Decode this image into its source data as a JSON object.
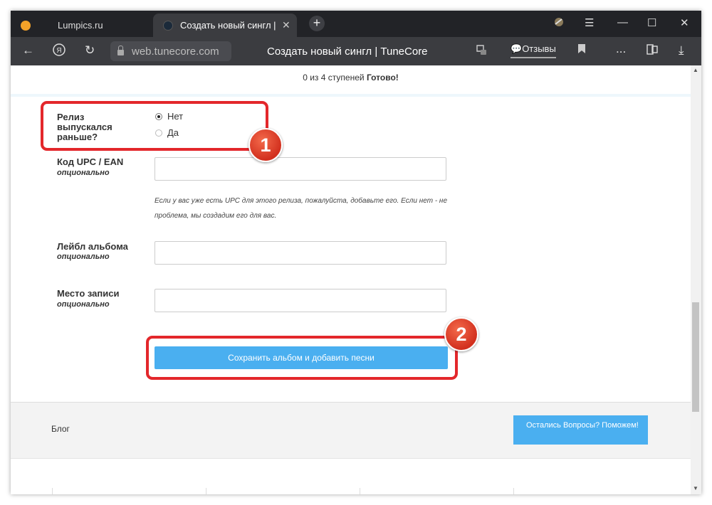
{
  "browser": {
    "tabs": [
      {
        "label": "Lumpics.ru",
        "active": false
      },
      {
        "label": "Создать новый сингл | TuneCore",
        "active": true
      }
    ],
    "new_tab_symbol": "+",
    "address": "web.tunecore.com",
    "page_title": "Создать новый сингл | TuneCore",
    "reviews_label": "Отзывы",
    "more_label": "...",
    "icons": [
      "back-icon",
      "yandex-icon",
      "reload-icon",
      "lock-icon",
      "extension-icon",
      "bookmark-icon",
      "collections-icon",
      "download-icon",
      "menu-icon",
      "minimize-icon",
      "maximize-icon",
      "close-icon"
    ]
  },
  "progress": {
    "text": "0 из 4 ступеней",
    "status": "Готово!"
  },
  "form": {
    "released_label": "Релиз выпускался раньше?",
    "released_options": [
      {
        "label": "Нет",
        "selected": true
      },
      {
        "label": "Да",
        "selected": false
      }
    ],
    "upc_label": "Код UPC / EAN",
    "upc_optional": "опционально",
    "upc_value": "",
    "upc_help": "Если у вас уже есть UPC для этого релиза, пожалуйста, добавьте его. Если нет - не проблема, мы создадим его для вас.",
    "label_label": "Лейбл альбома",
    "label_optional": "опционально",
    "label_value": "",
    "place_label": "Место записи",
    "place_optional": "опционально",
    "place_value": "",
    "save_button": "Сохранить альбом и добавить песни"
  },
  "annotations": {
    "badge1": "1",
    "badge2": "2",
    "highlight_color": "#e3272b"
  },
  "footer": {
    "blog": "Блог",
    "help_button": "Остались Вопросы? Поможем!"
  },
  "colors": {
    "accent": "#4aaff0",
    "browser_dark": "#222327"
  }
}
